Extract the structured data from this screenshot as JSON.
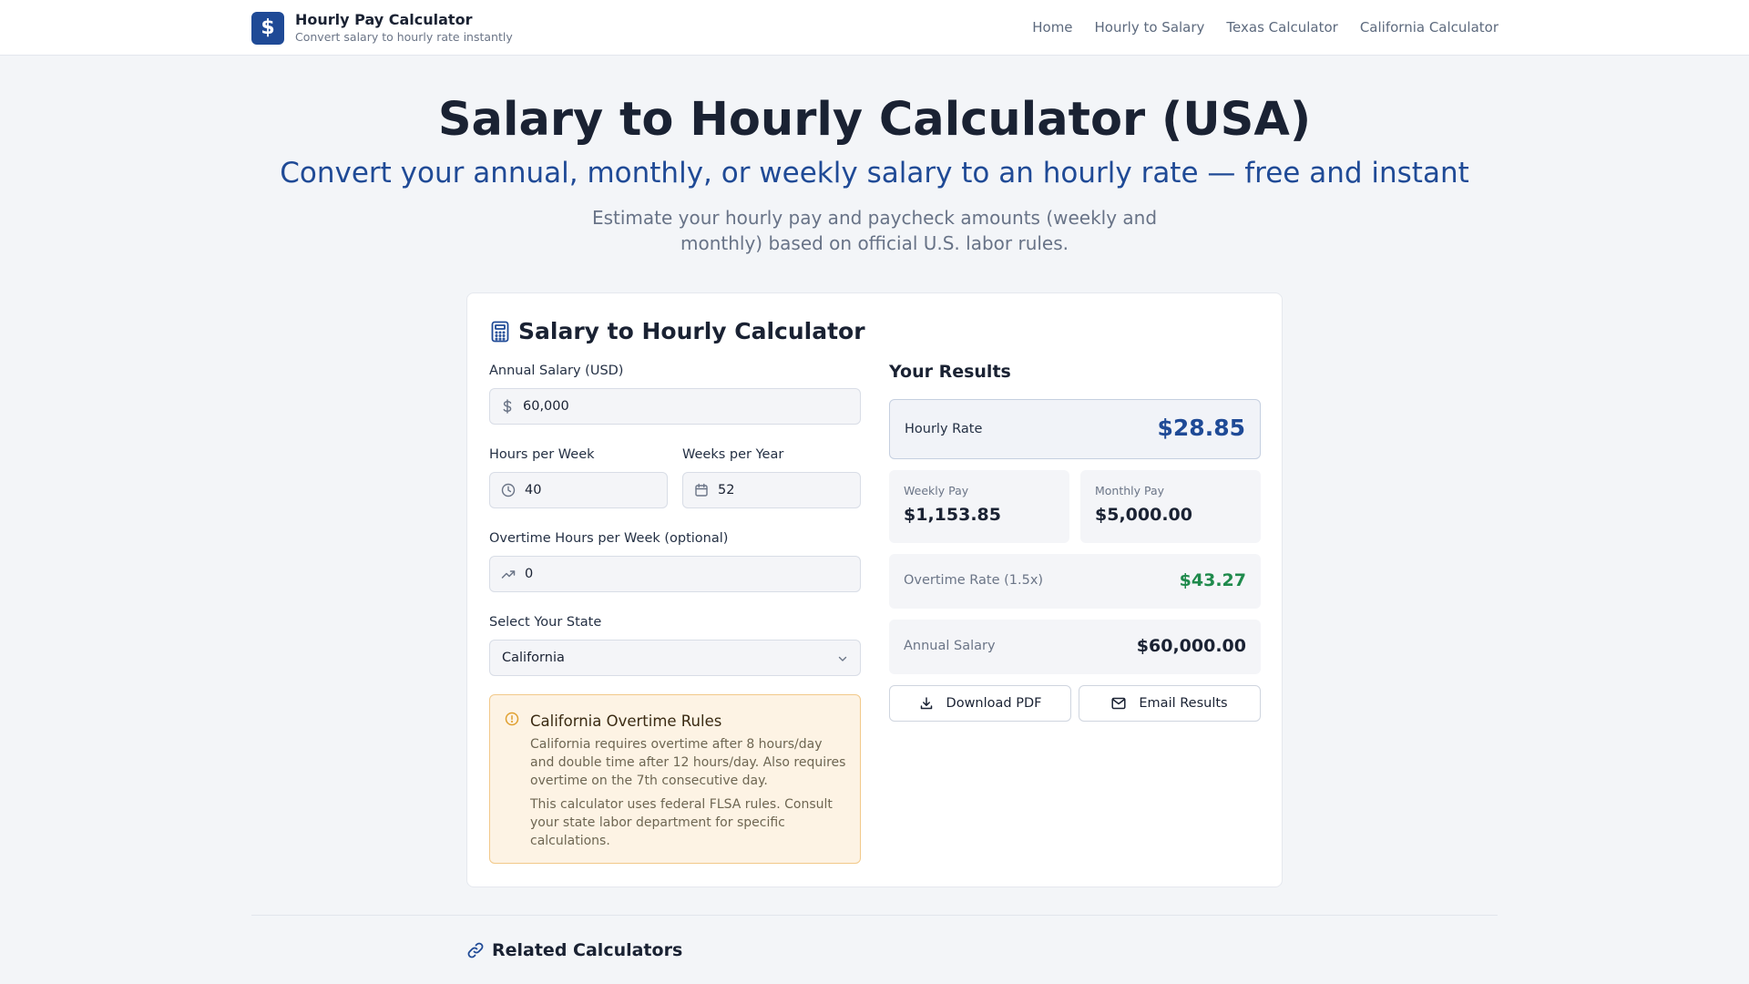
{
  "header": {
    "logo_glyph": "$",
    "title": "Hourly Pay Calculator",
    "subtitle": "Convert salary to hourly rate instantly",
    "nav": [
      "Home",
      "Hourly to Salary",
      "Texas Calculator",
      "California Calculator"
    ]
  },
  "hero": {
    "title": "Salary to Hourly Calculator (USA)",
    "subtitle": "Convert your annual, monthly, or weekly salary to an hourly rate — free and instant",
    "description": "Estimate your hourly pay and paycheck amounts (weekly and monthly) based on official U.S. labor rules."
  },
  "calculator": {
    "title": "Salary to Hourly Calculator",
    "annual_salary": {
      "label": "Annual Salary (USD)",
      "value": "60,000",
      "icon": "dollar-icon"
    },
    "hours_per_week": {
      "label": "Hours per Week",
      "value": "40",
      "icon": "clock-icon"
    },
    "weeks_per_year": {
      "label": "Weeks per Year",
      "value": "52",
      "icon": "calendar-icon"
    },
    "overtime_hours": {
      "label": "Overtime Hours per Week (optional)",
      "value": "0",
      "icon": "trending-up-icon"
    },
    "state": {
      "label": "Select Your State",
      "value": "California"
    },
    "alert": {
      "title": "California Overtime Rules",
      "text1": "California requires overtime after 8 hours/day and double time after 12 hours/day. Also requires overtime on the 7th consecutive day.",
      "text2": "This calculator uses federal FLSA rules. Consult your state labor department for specific calculations."
    }
  },
  "results": {
    "heading": "Your Results",
    "hourly_rate": {
      "label": "Hourly Rate",
      "value": "$28.85"
    },
    "weekly_pay": {
      "label": "Weekly Pay",
      "value": "$1,153.85"
    },
    "monthly_pay": {
      "label": "Monthly Pay",
      "value": "$5,000.00"
    },
    "overtime_rate": {
      "label": "Overtime Rate (1.5x)",
      "value": "$43.27"
    },
    "annual_salary": {
      "label": "Annual Salary",
      "value": "$60,000.00"
    },
    "download_label": "Download PDF",
    "email_label": "Email Results"
  },
  "related": {
    "title": "Related Calculators"
  },
  "colors": {
    "brand": "#1f4a96",
    "overtime_green": "#1f8a4c",
    "alert_bg": "#fdf3e4",
    "alert_border": "#f2c98a"
  }
}
